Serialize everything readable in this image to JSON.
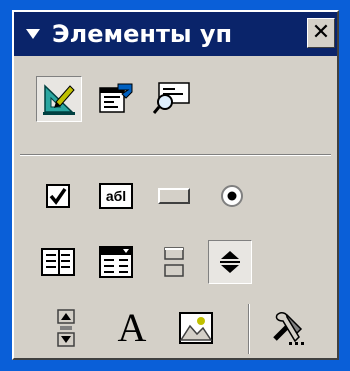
{
  "titlebar": {
    "title": "Элементы уп",
    "close_glyph": "✕"
  },
  "toolbar_top": [
    {
      "name": "design-mode-icon",
      "active": true
    },
    {
      "name": "properties-icon",
      "active": false
    },
    {
      "name": "view-code-icon",
      "active": false
    }
  ],
  "controls": {
    "label_text_sample": "абl",
    "label_big": "A"
  },
  "icons": [
    "checkbox-icon",
    "textbox-icon",
    "command-button-icon",
    "option-button-icon",
    "listbox-icon",
    "combobox-icon",
    "toggle-button-icon",
    "spin-button-icon",
    "scrollbar-icon",
    "label-icon",
    "image-icon",
    "more-controls-icon"
  ]
}
